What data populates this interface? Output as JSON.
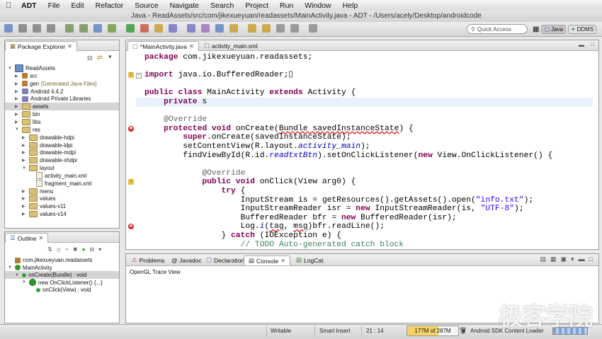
{
  "menubar": {
    "app": "ADT",
    "items": [
      "File",
      "Edit",
      "Refactor",
      "Source",
      "Navigate",
      "Search",
      "Project",
      "Run",
      "Window",
      "Help"
    ],
    "window_title": "Java - ReadAssets/src/com/jikexueyuan/readassets/MainActivity.java - ADT - /Users/acely/Desktop/androidcode"
  },
  "quick_access": {
    "placeholder": "Quick Access"
  },
  "perspectives": [
    {
      "label": "Java"
    },
    {
      "label": "DDMS"
    }
  ],
  "package_explorer": {
    "title": "Package Explorer",
    "items": [
      {
        "label": "ReadAssets",
        "depth": 0,
        "kind": "project",
        "expanded": true
      },
      {
        "label": "src",
        "depth": 1,
        "kind": "folder",
        "expanded": false
      },
      {
        "label": "gen",
        "suffix": "[Generated Java Files]",
        "depth": 1,
        "kind": "folder",
        "expanded": false
      },
      {
        "label": "Android 4.4.2",
        "depth": 1,
        "kind": "jar",
        "expanded": false
      },
      {
        "label": "Android Private Libraries",
        "depth": 1,
        "kind": "jar",
        "expanded": false
      },
      {
        "label": "assets",
        "depth": 1,
        "kind": "folder",
        "expanded": false,
        "selected": true
      },
      {
        "label": "bin",
        "depth": 1,
        "kind": "folder",
        "expanded": false
      },
      {
        "label": "libs",
        "depth": 1,
        "kind": "folder",
        "expanded": false
      },
      {
        "label": "res",
        "depth": 1,
        "kind": "folder",
        "expanded": true
      },
      {
        "label": "drawable-hdpi",
        "depth": 2,
        "kind": "folder",
        "expanded": false
      },
      {
        "label": "drawable-ldpi",
        "depth": 2,
        "kind": "folder",
        "expanded": false
      },
      {
        "label": "drawable-mdpi",
        "depth": 2,
        "kind": "folder",
        "expanded": false
      },
      {
        "label": "drawable-xhdpi",
        "depth": 2,
        "kind": "folder",
        "expanded": false
      },
      {
        "label": "layout",
        "depth": 2,
        "kind": "folder",
        "expanded": true
      },
      {
        "label": "activity_main.xml",
        "depth": 3,
        "kind": "xml"
      },
      {
        "label": "fragment_main.xml",
        "depth": 3,
        "kind": "xml"
      },
      {
        "label": "menu",
        "depth": 2,
        "kind": "folder",
        "expanded": false
      },
      {
        "label": "values",
        "depth": 2,
        "kind": "folder",
        "expanded": false
      },
      {
        "label": "values-v11",
        "depth": 2,
        "kind": "folder",
        "expanded": false
      },
      {
        "label": "values-v14",
        "depth": 2,
        "kind": "folder",
        "expanded": false
      }
    ]
  },
  "outline": {
    "title": "Outline",
    "items": [
      {
        "label": "com.jikexueyuan.readassets",
        "depth": 0,
        "kind": "package"
      },
      {
        "label": "MainActivity",
        "depth": 0,
        "kind": "class",
        "expanded": true
      },
      {
        "label": "onCreate(Bundle) : void",
        "depth": 1,
        "kind": "method",
        "selected": true,
        "expanded": true
      },
      {
        "label": "new OnClickListener() {...}",
        "depth": 2,
        "kind": "anon",
        "expanded": true
      },
      {
        "label": "onClick(View) : void",
        "depth": 3,
        "kind": "method"
      }
    ]
  },
  "editor": {
    "tabs": [
      {
        "label": "*MainActivity.java",
        "active": true
      },
      {
        "label": "activity_main.xml",
        "active": false
      }
    ],
    "lines": [
      {
        "row": 0,
        "html": "<span class=\"kw\">package</span> com.jikexueyuan.readassets;"
      },
      {
        "row": 2,
        "html": "<span class=\"kw\">import</span> java.io.BufferedReader;▯",
        "marker": "warn",
        "fold": "+"
      },
      {
        "row": 4,
        "html": "<span class=\"kw\">public class</span> MainActivity <span class=\"kw\">extends</span> Activity {"
      },
      {
        "row": 5,
        "html": "    <span class=\"kw\">private</span> s",
        "current": true
      },
      {
        "row": 7,
        "html": "    <span class=\"ann\">@Override</span>"
      },
      {
        "row": 8,
        "html": "    <span class=\"kw\">protected void</span> onCreate(<span class=\"ul\">Bundle savedInstanceState</span>) {",
        "marker": "error"
      },
      {
        "row": 9,
        "html": "        <span class=\"kw\">super</span>.onCreate(savedInstanceState);"
      },
      {
        "row": 10,
        "html": "        setContentView(R.layout.<span class=\"it\">activity_main</span>);"
      },
      {
        "row": 11,
        "html": "        findViewById(R.id.<span class=\"it\">readtxtBtn</span>).setOnClickListener(<span class=\"kw\">new</span> View.OnClickListener() {"
      },
      {
        "row": 13,
        "html": "            <span class=\"ann\">@Override</span>"
      },
      {
        "row": 14,
        "html": "            <span class=\"kw\">public void</span> onClick(View arg0) {",
        "marker": "warn"
      },
      {
        "row": 15,
        "html": "                <span class=\"kw\">try</span> {"
      },
      {
        "row": 16,
        "html": "                    InputStream is = getResources().getAssets().open(<span class=\"str\">\"info.txt\"</span>);"
      },
      {
        "row": 17,
        "html": "                    InputStreamReader isr = <span class=\"kw\">new</span> InputStreamReader(is, <span class=\"str\">\"UTF-8\"</span>);"
      },
      {
        "row": 18,
        "html": "                    BufferedReader bfr = <span class=\"kw\">new</span> BufferedReader(isr);"
      },
      {
        "row": 19,
        "html": "                    Log.<span class=\"it\">i</span>(<span class=\"ul\">tag</span>, <span class=\"ul\">msg</span>)bfr.readLine();",
        "marker": "error"
      },
      {
        "row": 20,
        "html": "                } <span class=\"kw\">catch</span> (IOException e) {"
      },
      {
        "row": 21,
        "html": "                    <span class=\"cm\">// TODO Auto-generated catch block</span>"
      }
    ]
  },
  "bottom_panel": {
    "tabs": [
      {
        "label": "Problems",
        "active": false
      },
      {
        "label": "@ Javadoc",
        "active": false
      },
      {
        "label": "Declaration",
        "active": false
      },
      {
        "label": "Console",
        "active": true
      },
      {
        "label": "LogCat",
        "active": false
      }
    ],
    "console_text": "OpenGL Trace View"
  },
  "statusbar": {
    "mode": "Writable",
    "insert": "Smart Insert",
    "position": "21 : 14",
    "memory": "177M of 287M",
    "memory_fraction": 0.617,
    "loader": "Android SDK Content Loader"
  },
  "watermark": "极客学院"
}
